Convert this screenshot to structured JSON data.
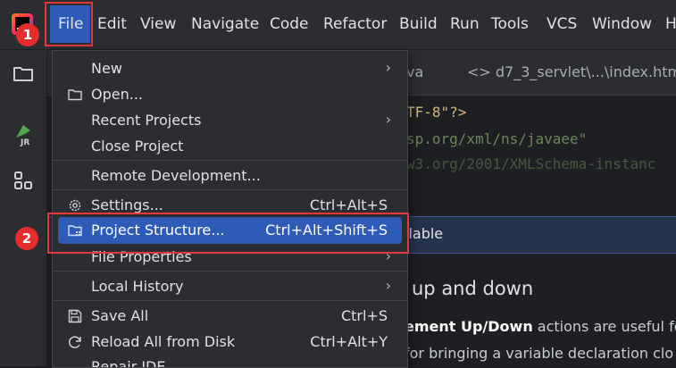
{
  "menubar": {
    "items": [
      {
        "label": "File"
      },
      {
        "label": "Edit"
      },
      {
        "label": "View"
      },
      {
        "label": "Navigate"
      },
      {
        "label": "Code"
      },
      {
        "label": "Refactor"
      },
      {
        "label": "Build"
      },
      {
        "label": "Run"
      },
      {
        "label": "Tools"
      },
      {
        "label": "VCS"
      },
      {
        "label": "Window"
      },
      {
        "label": "H"
      }
    ]
  },
  "badges": {
    "first": "1",
    "second": "2"
  },
  "editor": {
    "tabs": [
      {
        "label": "va"
      },
      {
        "label": "<> d7_3_servlet\\...\\index.htm"
      }
    ],
    "code_lines": [
      "TF-8\"?>",
      "sp.org/xml/ns/javaee\"",
      "w3.org/2001/XMLSchema-instanc"
    ],
    "notification": "ilable",
    "tip": {
      "title": "up and down",
      "line1_bold": "ement Up/Down",
      "line1_rest": " actions are useful fo",
      "line2": " for bringing a variable declaration clo"
    }
  },
  "file_menu": {
    "items": [
      {
        "label": "New",
        "shortcut": "",
        "submenu": true,
        "icon": ""
      },
      {
        "label": "Open...",
        "shortcut": "",
        "submenu": false,
        "icon": "folder-icon"
      },
      {
        "label": "Recent Projects",
        "shortcut": "",
        "submenu": true,
        "icon": ""
      },
      {
        "label": "Close Project",
        "shortcut": "",
        "submenu": false,
        "icon": ""
      },
      {
        "label": "Remote Development...",
        "shortcut": "",
        "submenu": false,
        "icon": ""
      },
      {
        "label": "Settings...",
        "shortcut": "Ctrl+Alt+S",
        "submenu": false,
        "icon": "gear-icon"
      },
      {
        "label": "Project Structure...",
        "shortcut": "Ctrl+Alt+Shift+S",
        "submenu": false,
        "icon": "project-structure-icon"
      },
      {
        "label": "File Properties",
        "shortcut": "",
        "submenu": true,
        "icon": ""
      },
      {
        "label": "Local History",
        "shortcut": "",
        "submenu": true,
        "icon": ""
      },
      {
        "label": "Save All",
        "shortcut": "Ctrl+S",
        "submenu": false,
        "icon": "save-icon"
      },
      {
        "label": "Reload All from Disk",
        "shortcut": "Ctrl+Alt+Y",
        "submenu": false,
        "icon": "reload-icon"
      },
      {
        "label": "Repair IDE",
        "shortcut": "",
        "submenu": false,
        "icon": ""
      }
    ],
    "submenu_arrow": "›"
  },
  "colors": {
    "accent": "#2e5bb8",
    "highlight_box": "#e03a3a",
    "badge": "#e52d2d"
  }
}
